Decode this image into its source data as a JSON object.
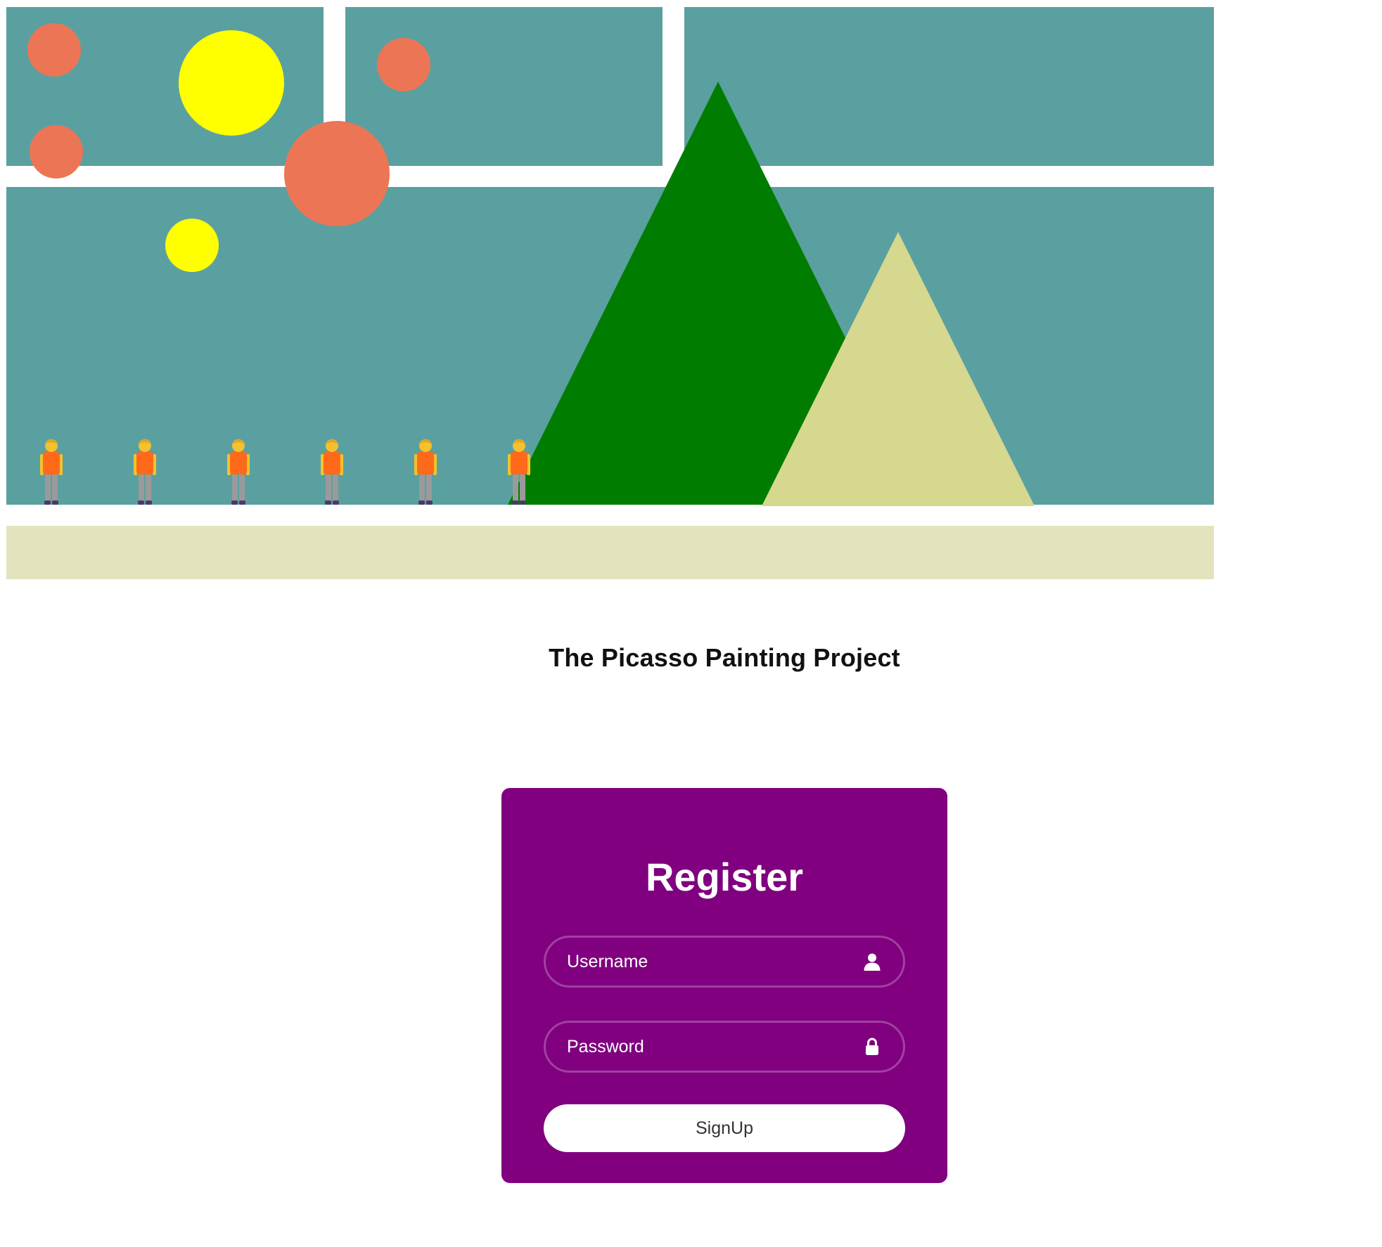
{
  "page": {
    "title": "The Picasso Painting Project"
  },
  "painting": {
    "panel_color": "#5ba0a0",
    "ground_color": "#e3e4bd",
    "orange_circle_color": "#ec7556",
    "yellow_circle_color": "#ffff00",
    "big_triangle_color": "#007d00",
    "small_triangle_color": "#d7d88f",
    "person_count": 6,
    "person_icon": "person-standing-icon"
  },
  "register": {
    "card_color": "#800080",
    "heading": "Register",
    "username_placeholder": "Username",
    "username_icon": "user-icon",
    "password_placeholder": "Password",
    "password_icon": "lock-icon",
    "signup_label": "SignUp"
  }
}
